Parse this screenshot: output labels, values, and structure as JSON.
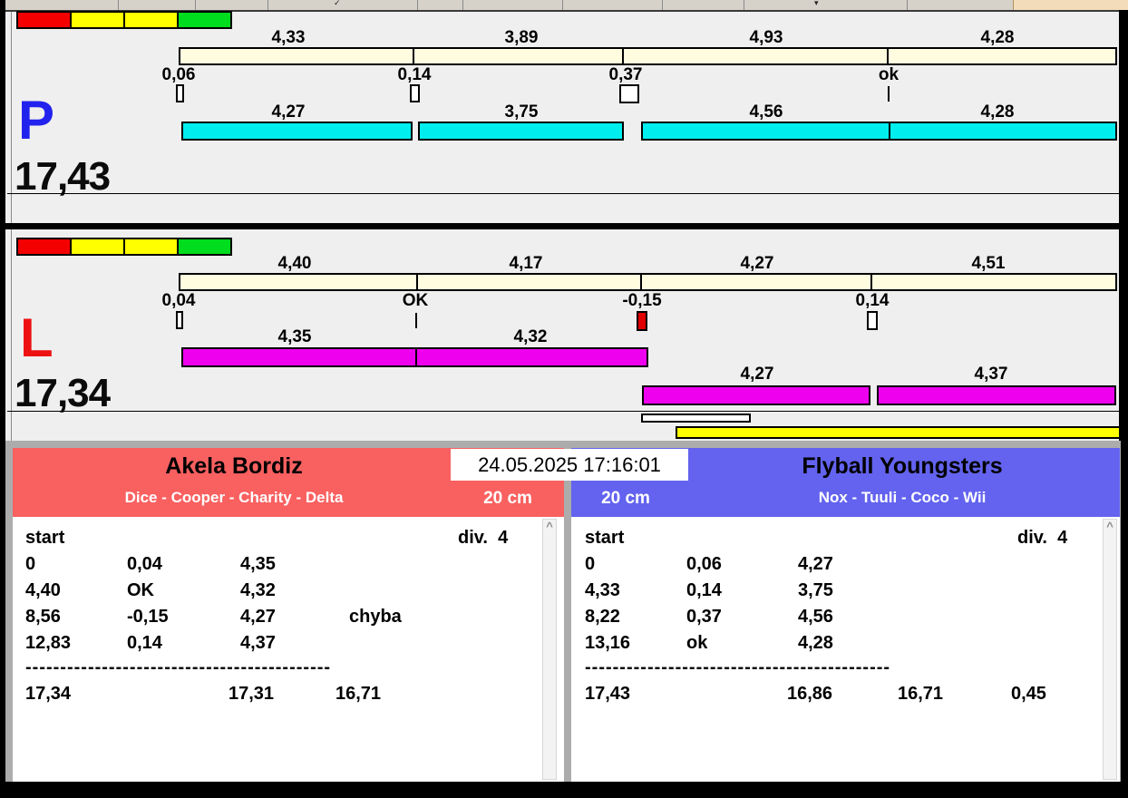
{
  "icons": {
    "check": "✓",
    "dropdown": "▾",
    "scroll_up": "^"
  },
  "datetime": "24.05.2025 17:16:01",
  "lane_p": {
    "letter": "P",
    "total": "17,43",
    "top_segments": [
      "4,33",
      "3,89",
      "4,93",
      "4,28"
    ],
    "ticks": [
      "0,06",
      "0,14",
      "0,37",
      "ok"
    ],
    "run_segments": [
      "4,27",
      "3,75",
      "4,56",
      "4,28"
    ],
    "colors": {
      "letter": "#2222EE",
      "run_bar": "#00EEEE",
      "scale_bar": "#FFFCE0"
    }
  },
  "lane_l": {
    "letter": "L",
    "total": "17,34",
    "top_segments": [
      "4,40",
      "4,17",
      "4,27",
      "4,51"
    ],
    "ticks": [
      "0,04",
      "OK",
      "-0,15",
      "0,14"
    ],
    "run_row1": [
      "4,35",
      "4,32"
    ],
    "run_row2": [
      "4,27",
      "4,37"
    ],
    "colors": {
      "letter": "#EE1111",
      "run_bar": "#EE00EE",
      "scale_bar": "#FFFCE0",
      "fault_tick": "#E00000"
    }
  },
  "team_left": {
    "name": "Akela Bordiz",
    "dogs": "Dice - Cooper - Charity - Delta",
    "jump_height": "20 cm",
    "header_color": "#F96060",
    "table": {
      "start_label": "start",
      "div_label": "div.  4",
      "rows": [
        [
          "0",
          "0,04",
          "4,35",
          ""
        ],
        [
          "4,40",
          "OK",
          "4,32",
          ""
        ],
        [
          "8,56",
          "-0,15",
          "4,27",
          "chyba"
        ],
        [
          "12,83",
          "0,14",
          "4,37",
          ""
        ]
      ],
      "separator": "--------------------------------------------",
      "totals": [
        "17,34",
        "17,31",
        "16,71"
      ]
    }
  },
  "team_right": {
    "name": "Flyball Youngsters",
    "dogs": "Nox - Tuuli - Coco - Wii",
    "jump_height": "20 cm",
    "header_color": "#6363EF",
    "table": {
      "start_label": "start",
      "div_label": "div.  4",
      "rows": [
        [
          "0",
          "0,06",
          "4,27",
          ""
        ],
        [
          "4,33",
          "0,14",
          "3,75",
          ""
        ],
        [
          "8,22",
          "0,37",
          "4,56",
          ""
        ],
        [
          "13,16",
          "ok",
          "4,28",
          ""
        ]
      ],
      "separator": "--------------------------------------------",
      "totals": [
        "17,43",
        "16,86",
        "16,71",
        "0,45"
      ]
    }
  }
}
